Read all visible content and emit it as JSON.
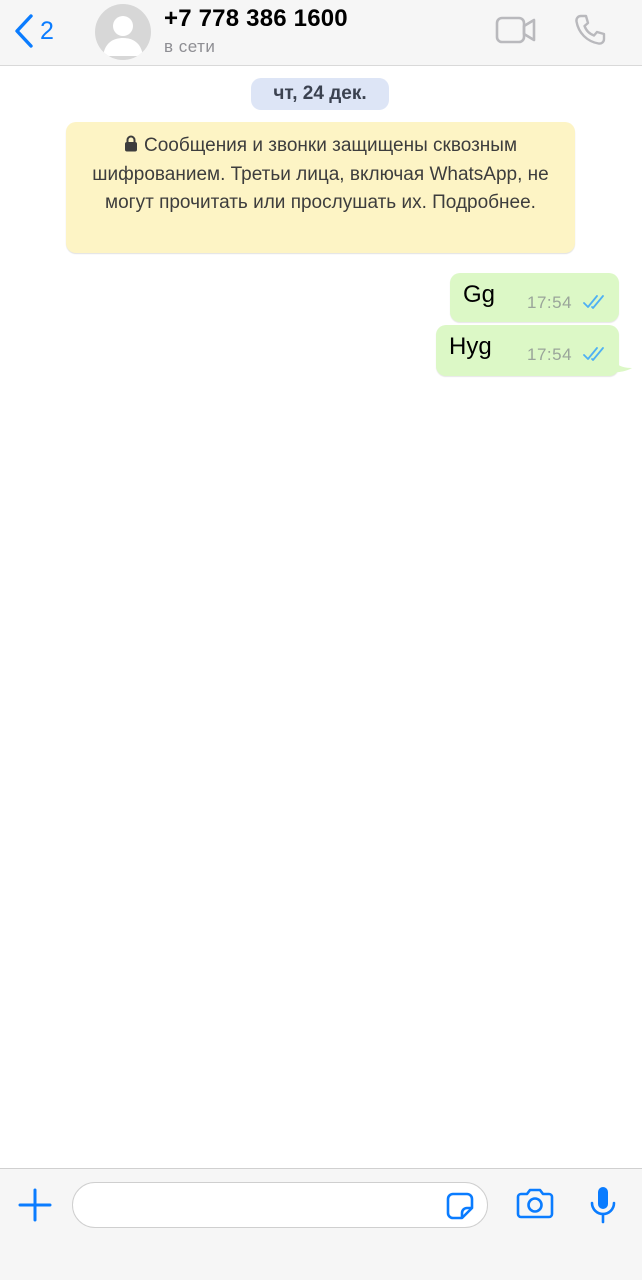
{
  "header": {
    "back_count": "2",
    "contact_name": "+7 778 386 1600",
    "status": "в сети",
    "icons": {
      "back": "chevron-left-icon",
      "avatar": "person-silhouette-icon",
      "video": "video-camera-icon",
      "call": "phone-icon"
    }
  },
  "chat": {
    "date_label": "чт, 24 дек.",
    "encryption_notice": "Сообщения и звонки защищены сквозным шифрованием. Третьи лица, включая WhatsApp, не могут прочитать или прослушать их. Подробнее.",
    "messages": [
      {
        "text": "Gg",
        "time": "17:54",
        "status": "read"
      },
      {
        "text": "Hyg",
        "time": "17:54",
        "status": "read"
      }
    ]
  },
  "composer": {
    "input_value": "",
    "icons": {
      "attach": "plus-icon",
      "sticker": "sticker-icon",
      "camera": "camera-icon",
      "mic": "microphone-icon"
    }
  },
  "colors": {
    "accent": "#0a7cff",
    "outgoing_bubble": "#dcf8c6",
    "notice_background": "#fdf4c5",
    "date_badge": "#dde5f6",
    "read_ticks": "#4fb0f3"
  }
}
